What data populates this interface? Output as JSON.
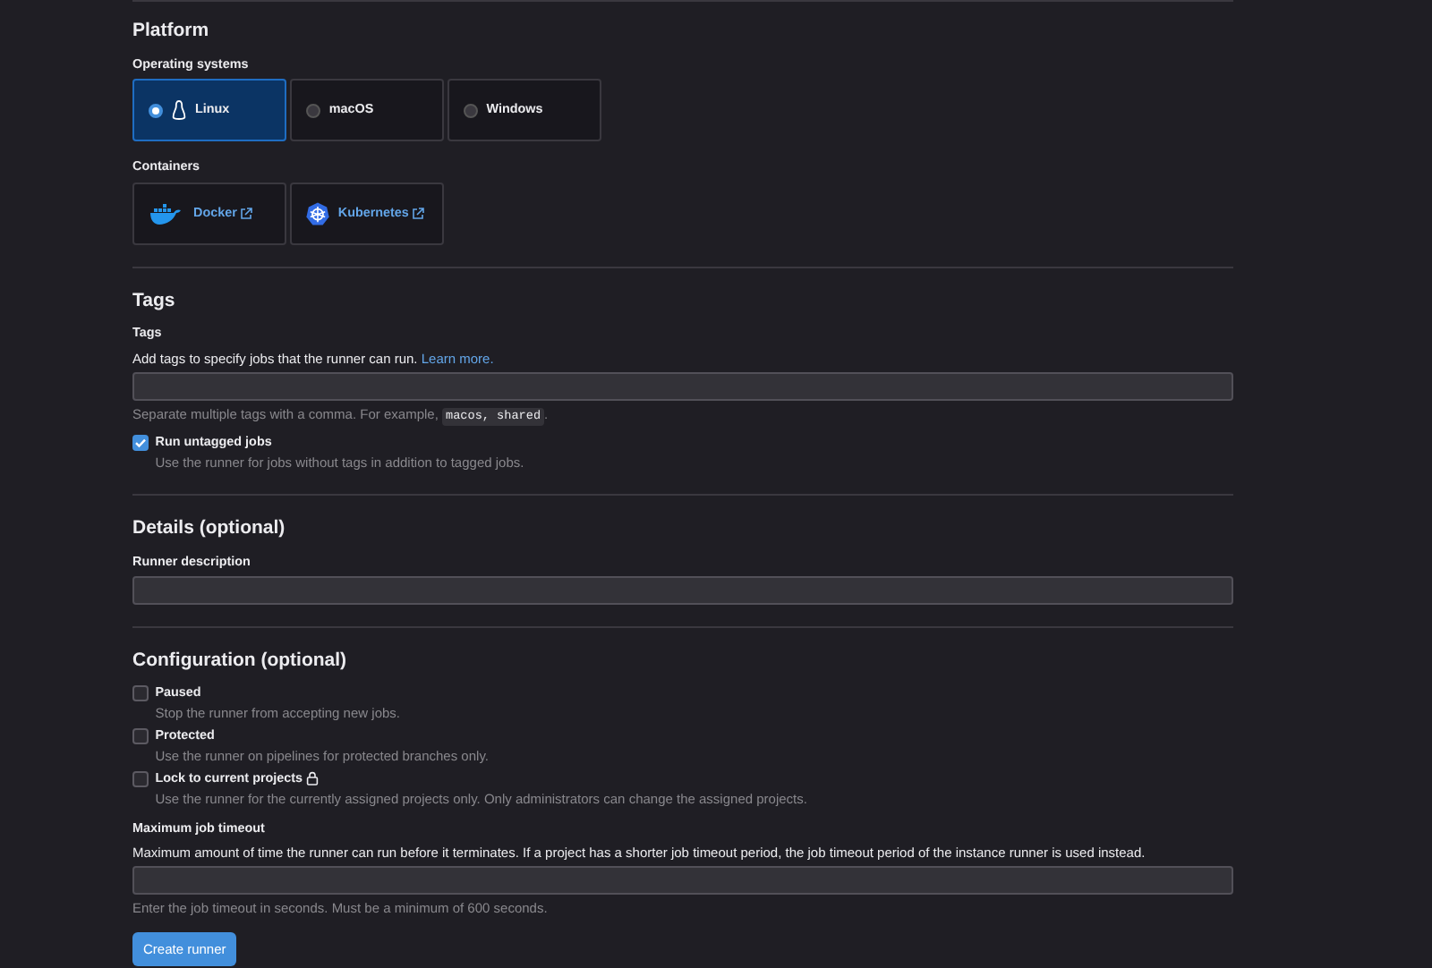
{
  "platform": {
    "title": "Platform",
    "os_label": "Operating systems",
    "os": [
      {
        "label": "Linux",
        "selected": true,
        "kind": "linux"
      },
      {
        "label": "macOS",
        "selected": false,
        "kind": "plain"
      },
      {
        "label": "Windows",
        "selected": false,
        "kind": "plain"
      }
    ],
    "containers_label": "Containers",
    "containers": [
      {
        "label": "Docker",
        "kind": "docker"
      },
      {
        "label": "Kubernetes",
        "kind": "kubernetes"
      }
    ]
  },
  "tags": {
    "title": "Tags",
    "label": "Tags",
    "help": "Add tags to specify jobs that the runner can run.",
    "help_link": "Learn more.",
    "hint_before": "Separate multiple tags with a comma. For example,",
    "hint_code": "macos, shared",
    "hint_after": ".",
    "options": [
      {
        "label": "Run untagged jobs",
        "description": "Use the runner for jobs without tags in addition to tagged jobs.",
        "checked": true
      }
    ]
  },
  "details": {
    "title": "Details (optional)",
    "label": "Runner description"
  },
  "configuration": {
    "title": "Configuration (optional)",
    "options": [
      {
        "label": "Paused",
        "description": "Stop the runner from accepting new jobs.",
        "checked": false
      },
      {
        "label": "Protected",
        "description": "Use the runner on pipelines for protected branches only.",
        "checked": false
      },
      {
        "label": "Lock to current projects",
        "description": "Use the runner for the currently assigned projects only. Only administrators can change the assigned projects.",
        "checked": false,
        "lock": true
      }
    ],
    "timeout_label": "Maximum job timeout",
    "timeout_help": "Maximum amount of time the runner can run before it terminates. If a project has a shorter job timeout period, the job timeout period of the instance runner is used instead.",
    "timeout_hint": "Enter the job timeout in seconds. Must be a minimum of 600 seconds."
  },
  "submit": "Create runner"
}
